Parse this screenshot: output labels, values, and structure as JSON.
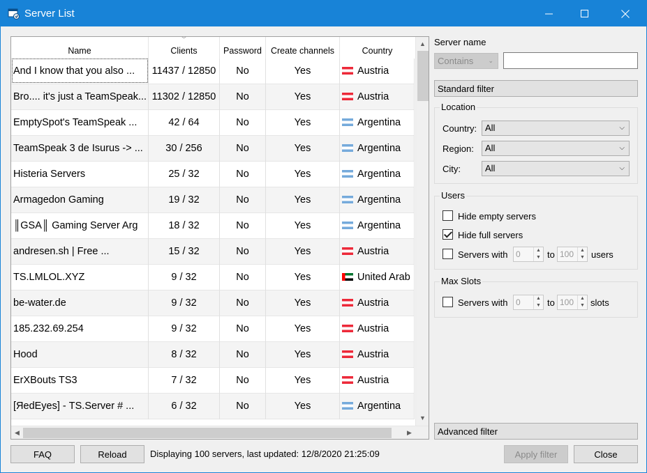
{
  "window": {
    "title": "Server List"
  },
  "table": {
    "columns": [
      "Name",
      "Clients",
      "Password",
      "Create channels",
      "Country"
    ],
    "rows": [
      {
        "name": "And I know that you also ...",
        "clients": "11437 / 12850",
        "password": "No",
        "channels": "Yes",
        "country": "Austria",
        "flag": "at"
      },
      {
        "name": "Bro.... it's just a TeamSpeak...",
        "clients": "11302 / 12850",
        "password": "No",
        "channels": "Yes",
        "country": "Austria",
        "flag": "at"
      },
      {
        "name": "EmptySpot's TeamSpeak ...",
        "clients": "42 / 64",
        "password": "No",
        "channels": "Yes",
        "country": "Argentina",
        "flag": "ar"
      },
      {
        "name": "TeamSpeak 3 de Isurus -> ...",
        "clients": "30 / 256",
        "password": "No",
        "channels": "Yes",
        "country": "Argentina",
        "flag": "ar"
      },
      {
        "name": "Histeria Servers",
        "clients": "25 / 32",
        "password": "No",
        "channels": "Yes",
        "country": "Argentina",
        "flag": "ar"
      },
      {
        "name": "Armagedon Gaming",
        "clients": "19 / 32",
        "password": "No",
        "channels": "Yes",
        "country": "Argentina",
        "flag": "ar"
      },
      {
        "name": "║GSA║ Gaming Server Arg",
        "clients": "18 / 32",
        "password": "No",
        "channels": "Yes",
        "country": "Argentina",
        "flag": "ar"
      },
      {
        "name": "andresen.sh | Free ...",
        "clients": "15 / 32",
        "password": "No",
        "channels": "Yes",
        "country": "Austria",
        "flag": "at"
      },
      {
        "name": "TS.LMLOL.XYZ",
        "clients": "9 / 32",
        "password": "No",
        "channels": "Yes",
        "country": "United Arab",
        "flag": "ae"
      },
      {
        "name": "be-water.de",
        "clients": "9 / 32",
        "password": "No",
        "channels": "Yes",
        "country": "Austria",
        "flag": "at"
      },
      {
        "name": "185.232.69.254",
        "clients": "9 / 32",
        "password": "No",
        "channels": "Yes",
        "country": "Austria",
        "flag": "at"
      },
      {
        "name": "Hood",
        "clients": "8 / 32",
        "password": "No",
        "channels": "Yes",
        "country": "Austria",
        "flag": "at"
      },
      {
        "name": "ErXBouts TS3",
        "clients": "7 / 32",
        "password": "No",
        "channels": "Yes",
        "country": "Austria",
        "flag": "at"
      },
      {
        "name": "[ЯedEyes] - TS.Server # ...",
        "clients": "6 / 32",
        "password": "No",
        "channels": "Yes",
        "country": "Argentina",
        "flag": "ar"
      }
    ]
  },
  "filters": {
    "server_name_label": "Server name",
    "match_mode": "Contains",
    "server_name_value": "",
    "standard_filter": "Standard filter",
    "location": {
      "title": "Location",
      "country_label": "Country:",
      "country_value": "All",
      "region_label": "Region:",
      "region_value": "All",
      "city_label": "City:",
      "city_value": "All"
    },
    "users": {
      "title": "Users",
      "hide_empty": "Hide empty servers",
      "hide_empty_checked": false,
      "hide_full": "Hide full servers",
      "hide_full_checked": true,
      "servers_with": "Servers with",
      "min": "0",
      "to": "to",
      "max": "100",
      "unit": "users"
    },
    "max_slots": {
      "title": "Max Slots",
      "servers_with": "Servers with",
      "min": "0",
      "to": "to",
      "max": "100",
      "unit": "slots"
    },
    "advanced_filter": "Advanced filter",
    "apply_filter": "Apply filter"
  },
  "footer": {
    "faq": "FAQ",
    "reload": "Reload",
    "status": "Displaying 100 servers, last updated: 12/8/2020 21:25:09",
    "close": "Close"
  }
}
